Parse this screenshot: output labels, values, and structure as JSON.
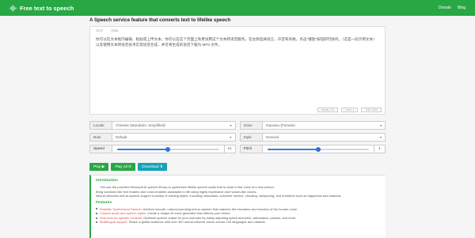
{
  "navbar": {
    "brand": "Free text to speech",
    "links": [
      "Donate",
      "Blog"
    ]
  },
  "headline": "A Speech service feature that converts text to lifelike speech",
  "editor": {
    "tabs": [
      "TEXT",
      "SSML"
    ],
    "text": "你可以在文本框内编辑、粘贴或上传文本。你可以在这个页面上免费试用这个文本转语音服务。在左侧选择语言、声音和风格，点击\"播放\"按钮即可收听。（这是一段示例文本）以及使用文本转语音技术实现语音合成，并可将生成的语音下载为 MP3 文件。",
    "footer": [
      "Words: 124",
      "Lines: 1",
      "Total: 3000"
    ]
  },
  "settings": {
    "locale_label": "Locale",
    "locale_value": "Chinese (Mandarin, Simplified)",
    "voice_label": "Voice",
    "voice_value": "Xiaoxiao (Female)",
    "role_label": "Role",
    "role_value": "Default",
    "style_label": "Style",
    "style_value": "General"
  },
  "sliders": {
    "speed_label": "Speed",
    "speed_value": "x1",
    "speed_fraction": 0.5,
    "pitch_label": "Pitch",
    "pitch_value": "1",
    "pitch_fraction": 0.5
  },
  "buttons": {
    "play": "Play ▶",
    "play_all": "Play all ⟳",
    "download": "Download ⬇"
  },
  "intro": {
    "title": "Introduction",
    "paragraphs": [
      "We use the powerful Microsoft AI speech library to synthesize lifelike speech audio that is close to the voice of a real person.",
      "Bring solutions like text readers and voice-enabled assistants to life using highly expressive and human-like voices.",
      "Neural networks text-to-speech support a variety of reading styles, including newscasts, customer service, shouting, whispering, and emotions such as happiness and sadness."
    ]
  },
  "features": {
    "title": "Features",
    "items": [
      {
        "name": "Realistic Synthesized Speech:",
        "desc": " Achieve smooth, natural-sounding text-to-speech that matches the intonation and emotion of the human voice."
      },
      {
        "name": "Custom audio and speech styles:",
        "desc": " Create a unique AI voice generator that reflects your brand."
      },
      {
        "name": "Fine-tune for specific contexts:",
        "desc": " Optimize speech output for your scenario by easily adjusting speed and pitch, articulation, pauses, and more."
      },
      {
        "name": "Multilingual support:",
        "desc": " Reach a global audience with over 400 neural network voices across 140 languages and variants."
      }
    ]
  }
}
